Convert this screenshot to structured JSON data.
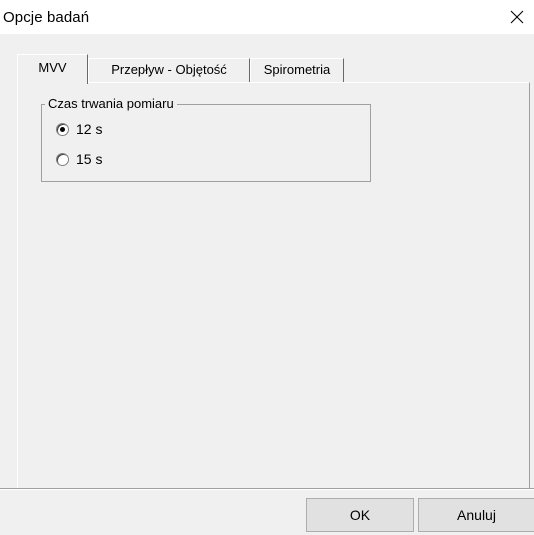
{
  "window": {
    "title": "Opcje badań",
    "close_icon": "close-icon"
  },
  "tabs": [
    {
      "label": "MVV",
      "active": true
    },
    {
      "label": "Przepływ - Objętość",
      "active": false
    },
    {
      "label": "Spirometria",
      "active": false
    }
  ],
  "groupbox": {
    "legend": "Czas trwania pomiaru",
    "options": [
      {
        "label": "12 s",
        "selected": true
      },
      {
        "label": "15 s",
        "selected": false
      }
    ]
  },
  "buttons": {
    "ok": "OK",
    "cancel": "Anuluj"
  }
}
